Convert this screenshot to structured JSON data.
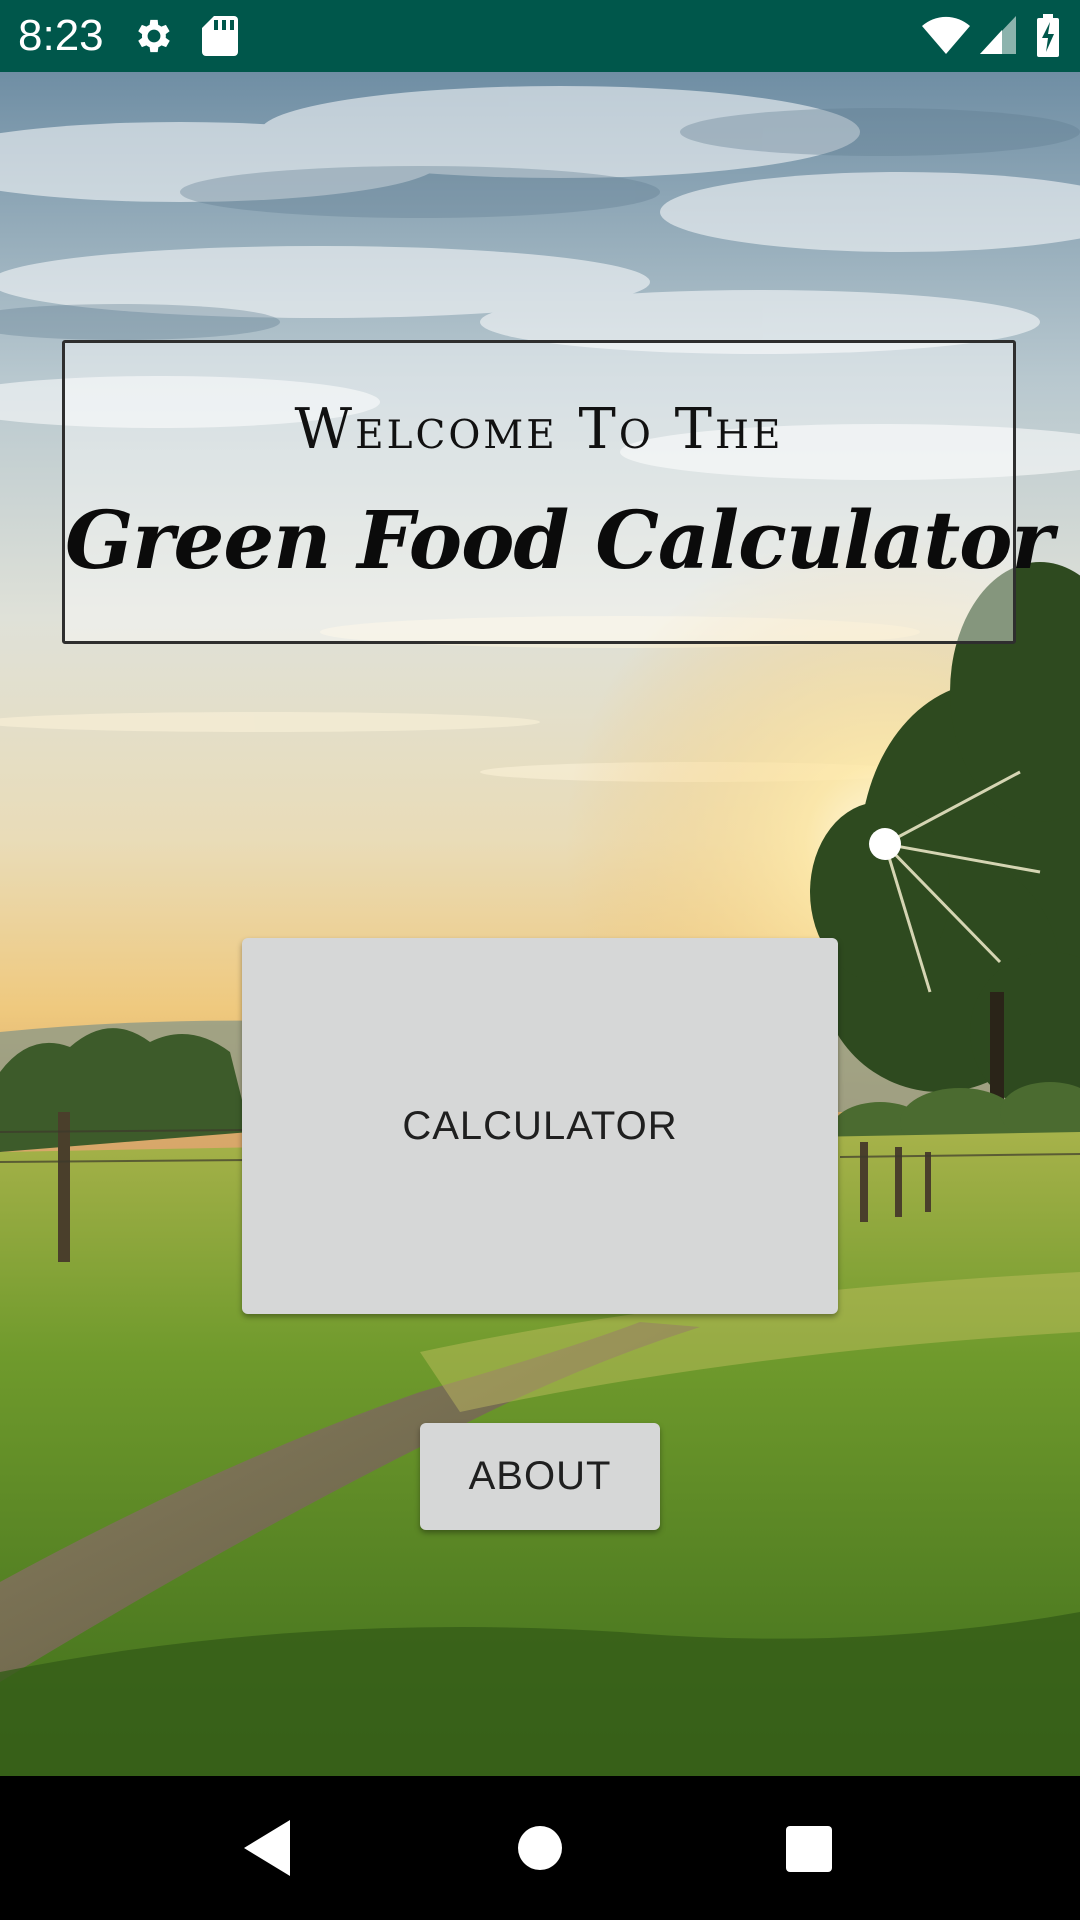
{
  "status_bar": {
    "time": "8:23",
    "background_color": "#00574B",
    "left_icons": [
      "settings-gear-icon",
      "sd-card-icon"
    ],
    "right_icons": [
      "wifi-icon",
      "cell-signal-icon",
      "battery-charging-icon"
    ]
  },
  "welcome_panel": {
    "welcome_text": "Welcome To The",
    "title": "Green Food Calculator"
  },
  "buttons": {
    "calculator_label": "CALCULATOR",
    "about_label": "ABOUT",
    "button_color": "#D6D7D7"
  },
  "nav_bar": {
    "icons": [
      "back-icon",
      "home-icon",
      "recents-icon"
    ]
  }
}
